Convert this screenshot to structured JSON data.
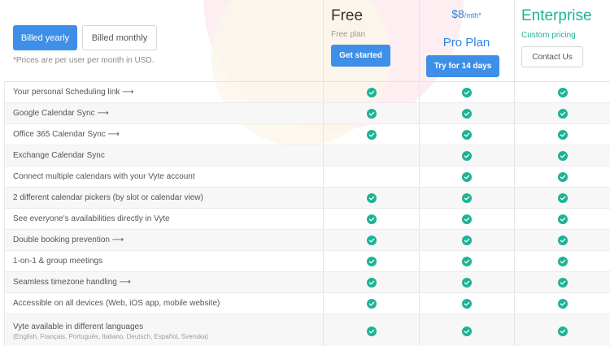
{
  "billing": {
    "yearly_label": "Billed yearly",
    "monthly_label": "Billed monthly",
    "selected": "yearly",
    "note": "*Prices are per user per month in USD."
  },
  "plans": {
    "free": {
      "title": "Free",
      "subtitle": "Free plan",
      "cta": "Get started"
    },
    "pro": {
      "price": "$8",
      "per": "/mth*",
      "title": "Pro Plan",
      "cta": "Try for 14 days"
    },
    "enterprise": {
      "title": "Enterprise",
      "subtitle": "Custom pricing",
      "cta": "Contact Us"
    }
  },
  "features": [
    {
      "label": "Your personal Scheduling link ⟶",
      "free": true,
      "pro": true,
      "enterprise": true
    },
    {
      "label": "Google Calendar Sync ⟶",
      "free": true,
      "pro": true,
      "enterprise": true
    },
    {
      "label": "Office 365 Calendar Sync ⟶",
      "free": true,
      "pro": true,
      "enterprise": true
    },
    {
      "label": "Exchange Calendar Sync",
      "free": false,
      "pro": true,
      "enterprise": true
    },
    {
      "label": "Connect multiple calendars with your Vyte account",
      "free": false,
      "pro": true,
      "enterprise": true
    },
    {
      "label": "2 different calendar pickers (by slot or calendar view)",
      "free": true,
      "pro": true,
      "enterprise": true
    },
    {
      "label": "See everyone's availabilities directly in Vyte",
      "free": true,
      "pro": true,
      "enterprise": true
    },
    {
      "label": "Double booking prevention ⟶",
      "free": true,
      "pro": true,
      "enterprise": true
    },
    {
      "label": "1-on-1 & group meetings",
      "free": true,
      "pro": true,
      "enterprise": true
    },
    {
      "label": "Seamless timezone handling ⟶",
      "free": true,
      "pro": true,
      "enterprise": true
    },
    {
      "label": "Accessible on all devices (Web, iOS app, mobile website)",
      "free": true,
      "pro": true,
      "enterprise": true
    },
    {
      "label": "Vyte available in different languages",
      "sub": "(English, Français, Português, Italiano, Deutsch, Español, Svenska)",
      "free": true,
      "pro": true,
      "enterprise": true
    }
  ],
  "colors": {
    "accent_blue": "#3d8fe8",
    "accent_green": "#1db394"
  },
  "icons": {
    "included": "check-circle-icon"
  }
}
